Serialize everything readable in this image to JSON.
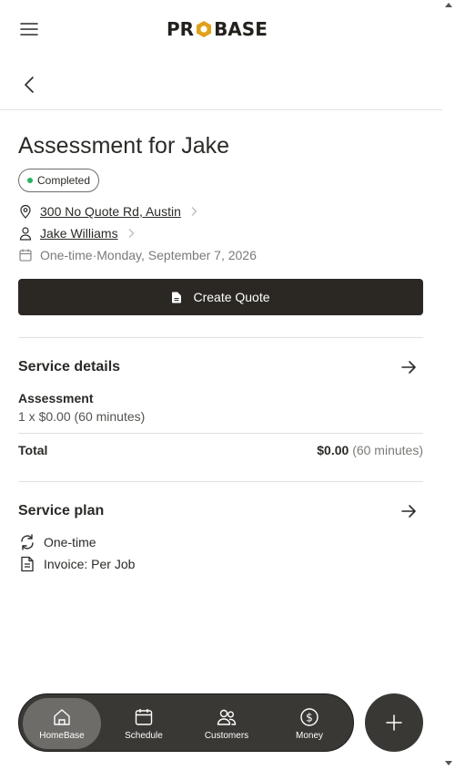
{
  "brand": {
    "logo_left": "PR",
    "logo_right": "BASE"
  },
  "page": {
    "title": "Assessment for Jake",
    "status": "Completed",
    "address": "300 No Quote Rd, Austin",
    "customer": "Jake Williams",
    "schedule_type": "One-time",
    "schedule_sep": "·",
    "schedule_date": "Monday, September 7, 2026",
    "create_quote_label": "Create Quote"
  },
  "service_details": {
    "title": "Service details",
    "item_name": "Assessment",
    "item_line": "1 x $0.00 (60 minutes)",
    "total_label": "Total",
    "total_amount": "$0.00",
    "total_duration": "(60 minutes)"
  },
  "service_plan": {
    "title": "Service plan",
    "frequency": "One-time",
    "invoice": "Invoice: Per Job"
  },
  "bottom_nav": {
    "items": [
      {
        "label": "HomeBase",
        "icon": "home-icon",
        "active": true
      },
      {
        "label": "Schedule",
        "icon": "calendar-icon",
        "active": false
      },
      {
        "label": "Customers",
        "icon": "customers-icon",
        "active": false
      },
      {
        "label": "Money",
        "icon": "money-icon",
        "active": false
      }
    ],
    "fab_icon": "plus-icon"
  },
  "colors": {
    "status_dot": "#26b463",
    "primary_dark": "#2b2824",
    "logo_accent": "#e0a11b",
    "nav_bg": "#3a3835"
  }
}
